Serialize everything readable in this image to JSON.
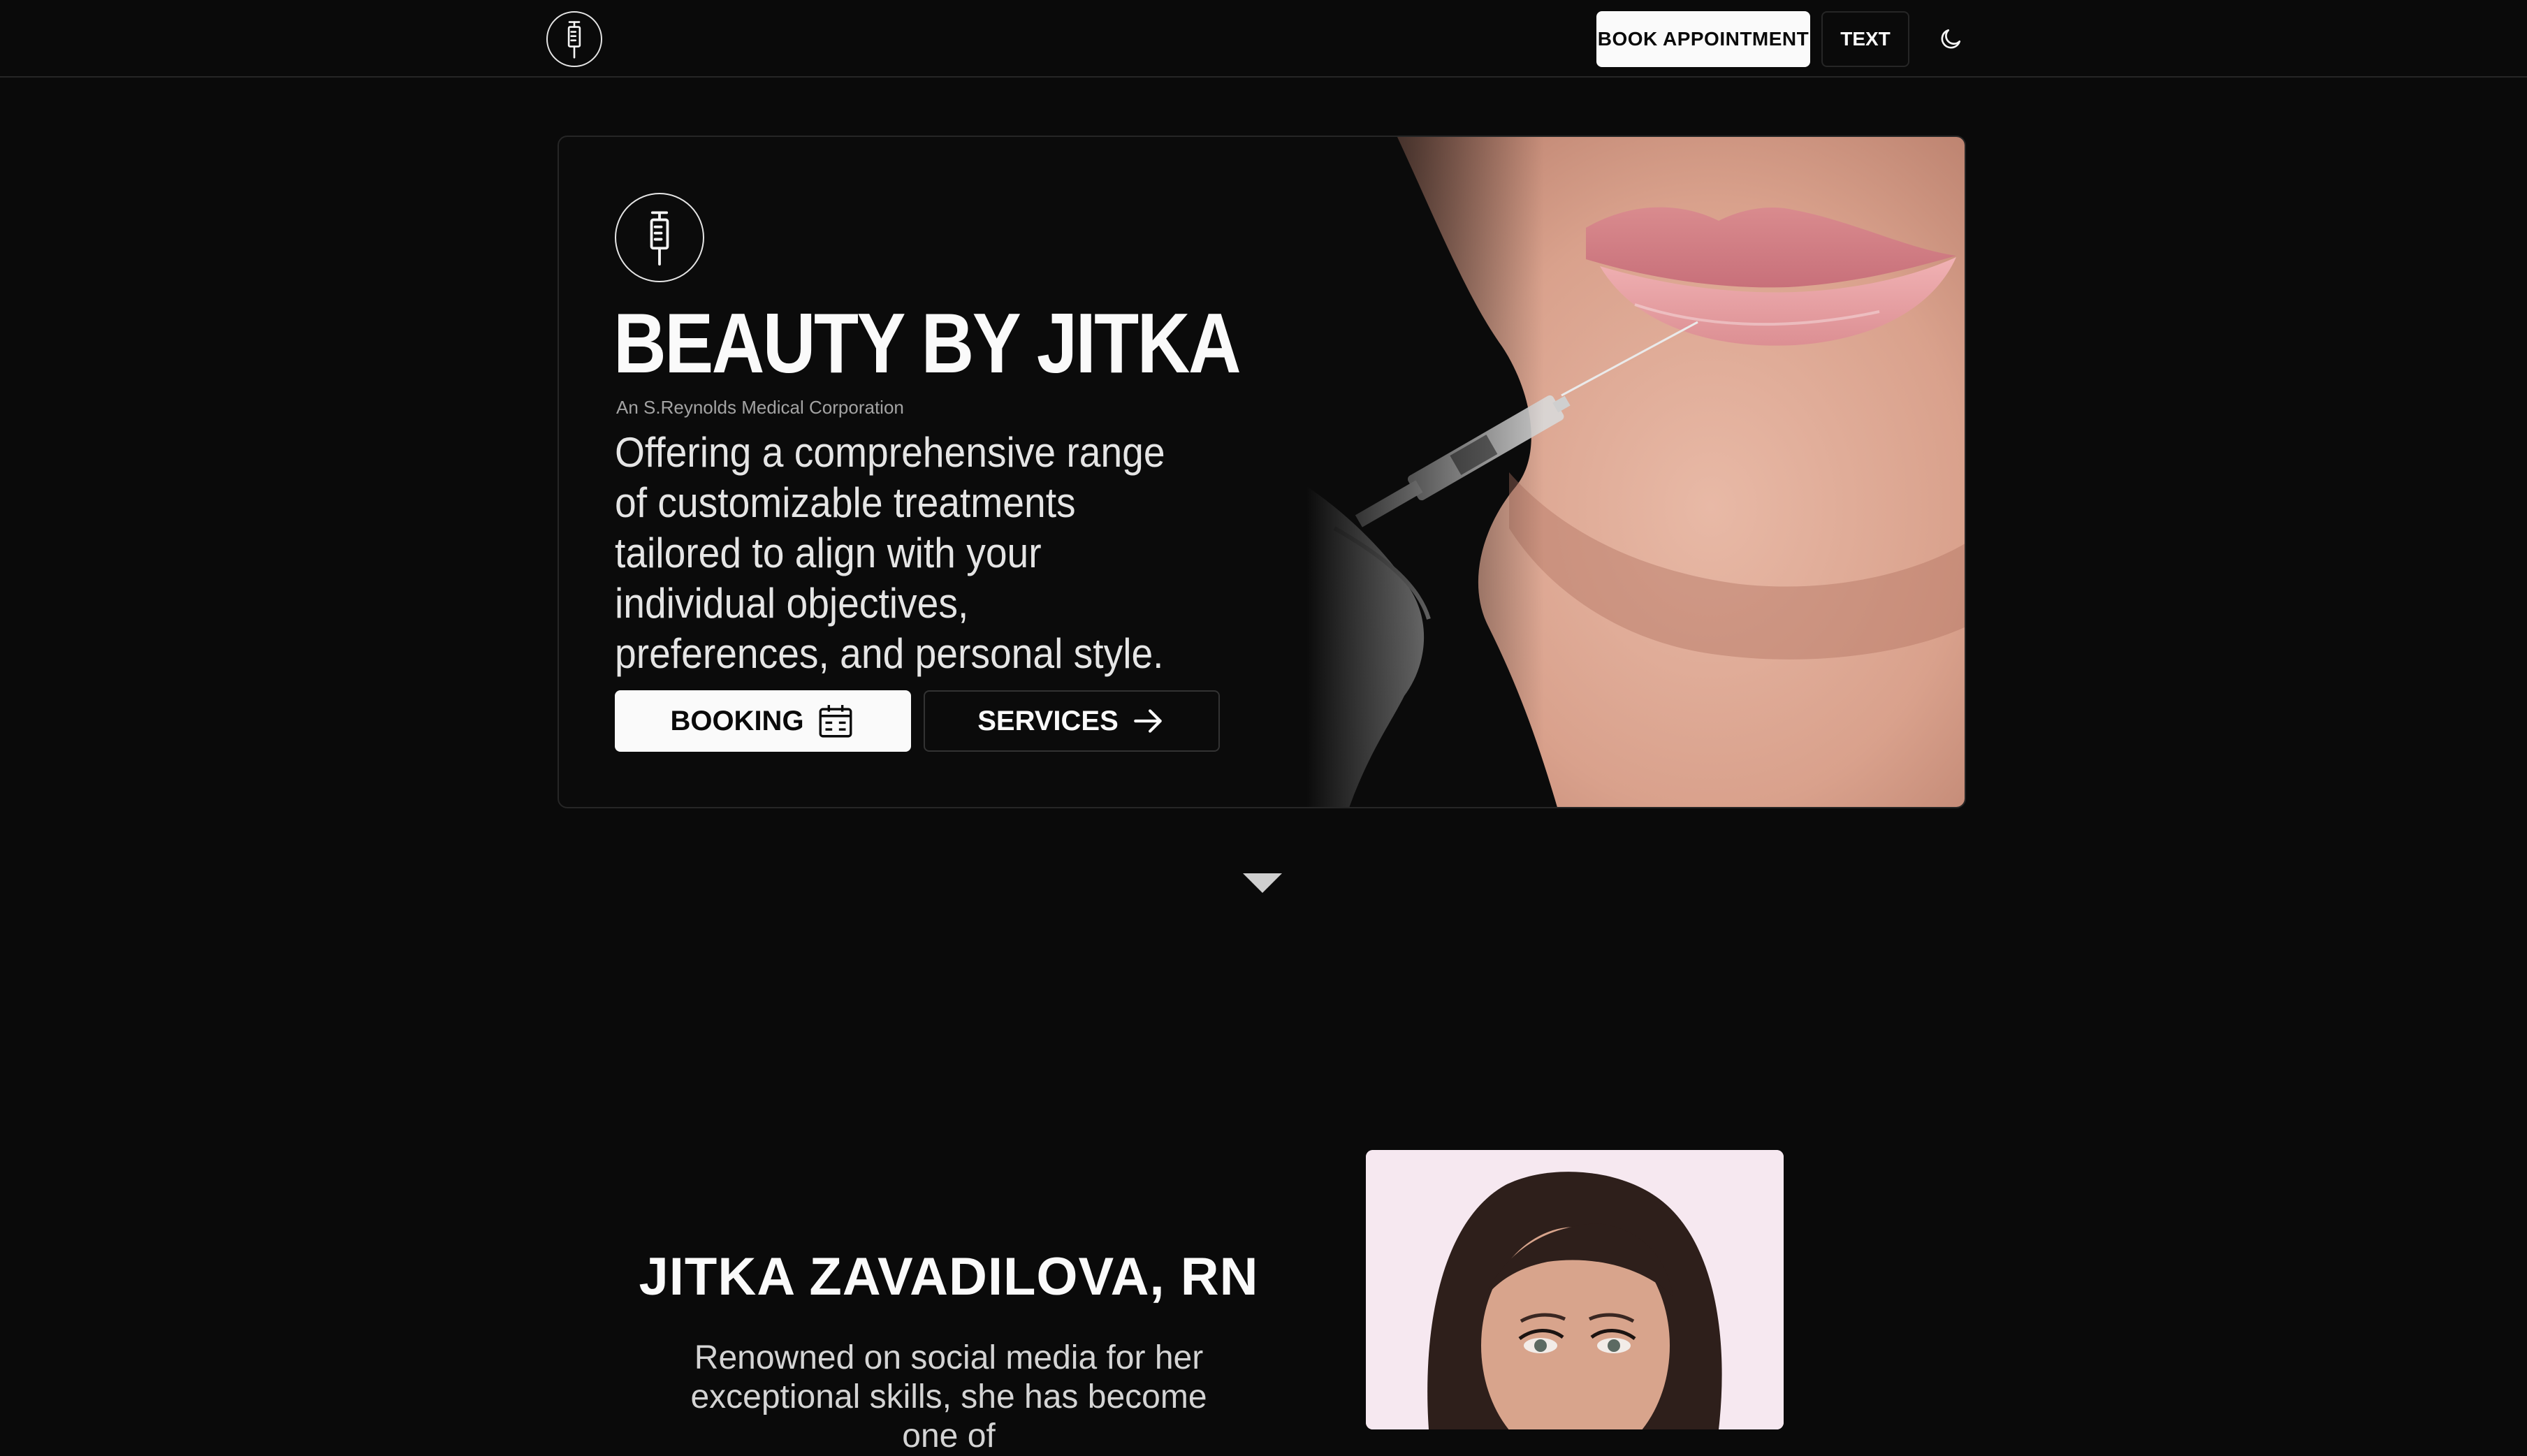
{
  "header": {
    "logo_icon": "syringe-icon",
    "book_button_label": "BOOK APPOINTMENT",
    "text_button_label": "TEXT",
    "theme_toggle_icon": "moon-icon"
  },
  "hero": {
    "logo_icon": "syringe-icon",
    "title": "BEAUTY BY JITKA",
    "subtitle": "An S.Reynolds Medical Corporation",
    "description": "Offering a comprehensive range of customizable treatments tailored to align with your individual objectives, preferences, and personal style.",
    "booking_button_label": "BOOKING",
    "booking_icon": "calendar-icon",
    "services_button_label": "SERVICES",
    "services_icon": "arrow-right-icon",
    "image_subject": "lip filler injection photo"
  },
  "scroll_icon": "caret-down-icon",
  "about": {
    "name": "JITKA ZAVADILOVA, RN",
    "bio": "Renowned on social media for her exceptional skills, she has become one of",
    "portrait_subject": "portrait photo"
  },
  "colors": {
    "background": "#0a0a0a",
    "foreground": "#fafafa",
    "border": "#262626",
    "portrait_bg": "#f6e8f0"
  }
}
